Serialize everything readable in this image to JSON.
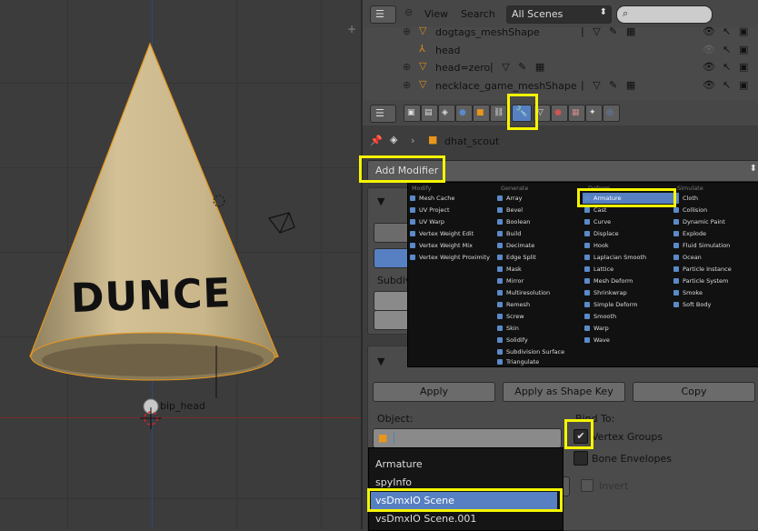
{
  "viewport": {
    "cone_text": "DUNCE",
    "bone_label": "bip_head",
    "corner_plus": "+"
  },
  "outliner": {
    "view_label": "View",
    "search_label": "Search",
    "scene_dropdown": "All Scenes",
    "search_placeholder": "",
    "rows": [
      {
        "name": "dogtags_meshShape",
        "type": "mesh"
      },
      {
        "name": "head",
        "type": "bone"
      },
      {
        "name": "head=zero",
        "type": "mesh"
      },
      {
        "name": "necklace_game_meshShape",
        "type": "mesh"
      }
    ]
  },
  "properties": {
    "breadcrumb_object": "dhat_scout",
    "add_modifier_label": "Add Modifier",
    "active_tab": "modifiers",
    "subdiv_label": "Subdiv",
    "apply_label": "Apply",
    "apply_shape_label": "Apply as Shape Key",
    "copy_label": "Copy",
    "object_label": "Object:",
    "bind_to_label": "Bind To:",
    "vertex_groups_label": "Vertex Groups",
    "vertex_groups_checked": true,
    "bone_envelopes_label": "Bone Envelopes",
    "bone_envelopes_checked": false,
    "invert_label": "Invert",
    "invert_checked": false
  },
  "modifier_menu": {
    "columns": [
      {
        "header": "Modify",
        "items": [
          "Mesh Cache",
          "UV Project",
          "UV Warp",
          "Vertex Weight Edit",
          "Vertex Weight Mix",
          "Vertex Weight Proximity"
        ]
      },
      {
        "header": "Generate",
        "items": [
          "Array",
          "Bevel",
          "Boolean",
          "Build",
          "Decimate",
          "Edge Split",
          "Mask",
          "Mirror",
          "Multiresolution",
          "Remesh",
          "Screw",
          "Skin",
          "Solidify",
          "Subdivision Surface",
          "Triangulate"
        ]
      },
      {
        "header": "Deform",
        "items": [
          "Armature",
          "Cast",
          "Curve",
          "Displace",
          "Hook",
          "Laplacian Smooth",
          "Lattice",
          "Mesh Deform",
          "Shrinkwrap",
          "Simple Deform",
          "Smooth",
          "Warp",
          "Wave"
        ]
      },
      {
        "header": "Simulate",
        "items": [
          "Cloth",
          "Collision",
          "Dynamic Paint",
          "Explode",
          "Fluid Simulation",
          "Ocean",
          "Particle Instance",
          "Particle System",
          "Smoke",
          "Soft Body"
        ]
      }
    ],
    "selected": "Armature"
  },
  "object_dropdown": {
    "options": [
      "Armature",
      "spyInfo",
      "vsDmxIO Scene",
      "vsDmxIO Scene.001"
    ],
    "selected": "vsDmxIO Scene"
  },
  "colors": {
    "highlight": "#f5f500",
    "selection": "#5680c2",
    "cone": "#c9b68a",
    "outline_orange": "#e8961c"
  }
}
